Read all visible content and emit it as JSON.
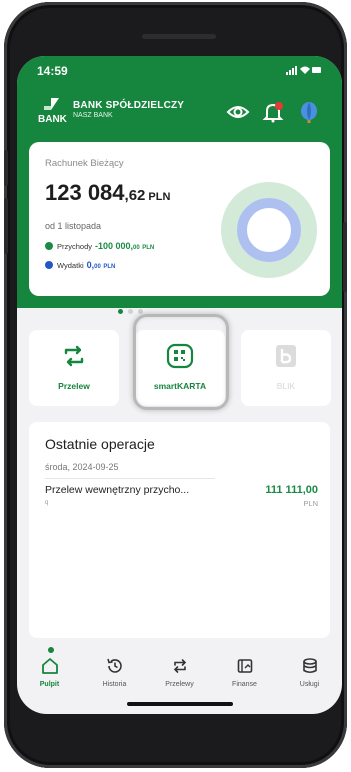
{
  "status_bar": {
    "time": "14:59"
  },
  "header": {
    "logo_text": "BANK",
    "bank_name": "BANK SPÓŁDZIELCZY",
    "bank_subtitle": "NASZ BANK",
    "icons": [
      "eye-icon",
      "bell-icon",
      "balloon-icon"
    ]
  },
  "account_card": {
    "account_name": "Rachunek Bieżący",
    "balance_integer": "123 084",
    "balance_decimal": ",62",
    "currency": "PLN",
    "period": "od 1 listopada",
    "income_label": "Przychody",
    "income_amount": "-100 000,",
    "income_decimal": "00",
    "income_currency": "PLN",
    "expense_label": "Wydatki",
    "expense_amount": "0,",
    "expense_decimal": "00",
    "expense_currency": "PLN"
  },
  "carousel": {
    "pages": 3,
    "active": 0
  },
  "quick_actions": [
    {
      "label": "Przelew",
      "icon": "transfer-icon",
      "enabled": true
    },
    {
      "label": "smartKARTA",
      "icon": "qr-card-icon",
      "enabled": true
    },
    {
      "label": "BLIK",
      "icon": "blik-icon",
      "enabled": false
    }
  ],
  "recent_operations": {
    "title": "Ostatnie operacje",
    "date": "środa, 2024-09-25",
    "items": [
      {
        "description": "Przelew wewnętrzny przycho...",
        "subtitle": "q",
        "amount": "111 111,00",
        "currency": "PLN"
      }
    ]
  },
  "bottom_nav": {
    "active": 0,
    "items": [
      {
        "label": "Pulpit",
        "icon": "home-icon"
      },
      {
        "label": "Historia",
        "icon": "history-icon"
      },
      {
        "label": "Przelewy",
        "icon": "transfers-icon"
      },
      {
        "label": "Finanse",
        "icon": "finance-icon"
      },
      {
        "label": "Usługi",
        "icon": "services-icon"
      }
    ]
  },
  "colors": {
    "brand_green": "#16853d",
    "income_green": "#1a8a45",
    "expense_blue": "#2356c7",
    "donut_green": "#d4ead9",
    "donut_blue": "#aec0f0"
  }
}
